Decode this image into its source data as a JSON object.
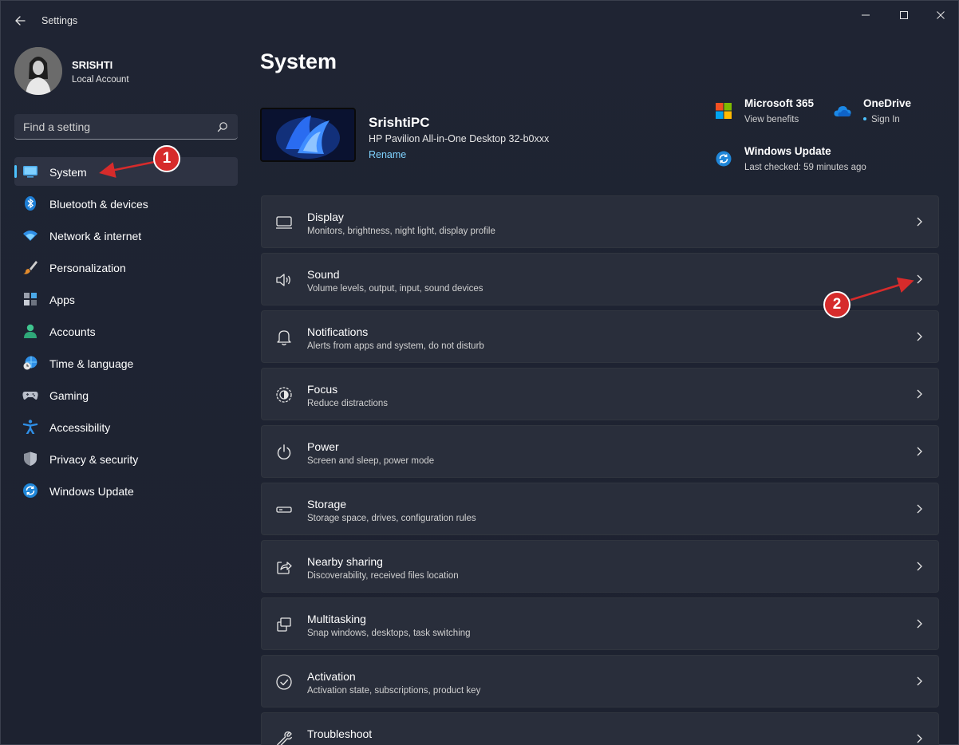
{
  "window": {
    "title": "Settings"
  },
  "profile": {
    "name": "SRISHTI",
    "account_type": "Local Account"
  },
  "search": {
    "placeholder": "Find a setting"
  },
  "sidebar": {
    "items": [
      {
        "label": "System",
        "icon": "monitor-icon",
        "active": true
      },
      {
        "label": "Bluetooth & devices",
        "icon": "bluetooth-icon"
      },
      {
        "label": "Network & internet",
        "icon": "wifi-icon"
      },
      {
        "label": "Personalization",
        "icon": "brush-icon"
      },
      {
        "label": "Apps",
        "icon": "apps-icon"
      },
      {
        "label": "Accounts",
        "icon": "person-icon"
      },
      {
        "label": "Time & language",
        "icon": "globe-clock-icon"
      },
      {
        "label": "Gaming",
        "icon": "gamepad-icon"
      },
      {
        "label": "Accessibility",
        "icon": "accessibility-icon"
      },
      {
        "label": "Privacy & security",
        "icon": "shield-icon"
      },
      {
        "label": "Windows Update",
        "icon": "update-icon"
      }
    ]
  },
  "main": {
    "title": "System",
    "device": {
      "name": "SrishtiPC",
      "model": "HP Pavilion All-in-One Desktop 32-b0xxx",
      "rename_label": "Rename"
    },
    "services": {
      "m365": {
        "title": "Microsoft 365",
        "sub": "View benefits"
      },
      "onedrive": {
        "title": "OneDrive",
        "sub": "Sign In"
      },
      "update": {
        "title": "Windows Update",
        "sub": "Last checked: 59 minutes ago"
      }
    },
    "cards": [
      {
        "title": "Display",
        "sub": "Monitors, brightness, night light, display profile",
        "icon": "display-icon"
      },
      {
        "title": "Sound",
        "sub": "Volume levels, output, input, sound devices",
        "icon": "speaker-icon"
      },
      {
        "title": "Notifications",
        "sub": "Alerts from apps and system, do not disturb",
        "icon": "bell-icon"
      },
      {
        "title": "Focus",
        "sub": "Reduce distractions",
        "icon": "focus-icon"
      },
      {
        "title": "Power",
        "sub": "Screen and sleep, power mode",
        "icon": "power-icon"
      },
      {
        "title": "Storage",
        "sub": "Storage space, drives, configuration rules",
        "icon": "storage-icon"
      },
      {
        "title": "Nearby sharing",
        "sub": "Discoverability, received files location",
        "icon": "share-icon"
      },
      {
        "title": "Multitasking",
        "sub": "Snap windows, desktops, task switching",
        "icon": "multitask-icon"
      },
      {
        "title": "Activation",
        "sub": "Activation state, subscriptions, product key",
        "icon": "check-circle-icon"
      },
      {
        "title": "Troubleshoot",
        "sub": "",
        "icon": "wrench-icon"
      }
    ]
  },
  "annotations": {
    "badge1": "1",
    "badge2": "2",
    "color": "#d62b2b"
  },
  "colors": {
    "accent": "#4cc2ff",
    "link": "#7fd3ff",
    "background": "#1c2130",
    "card": "#292e3b"
  }
}
